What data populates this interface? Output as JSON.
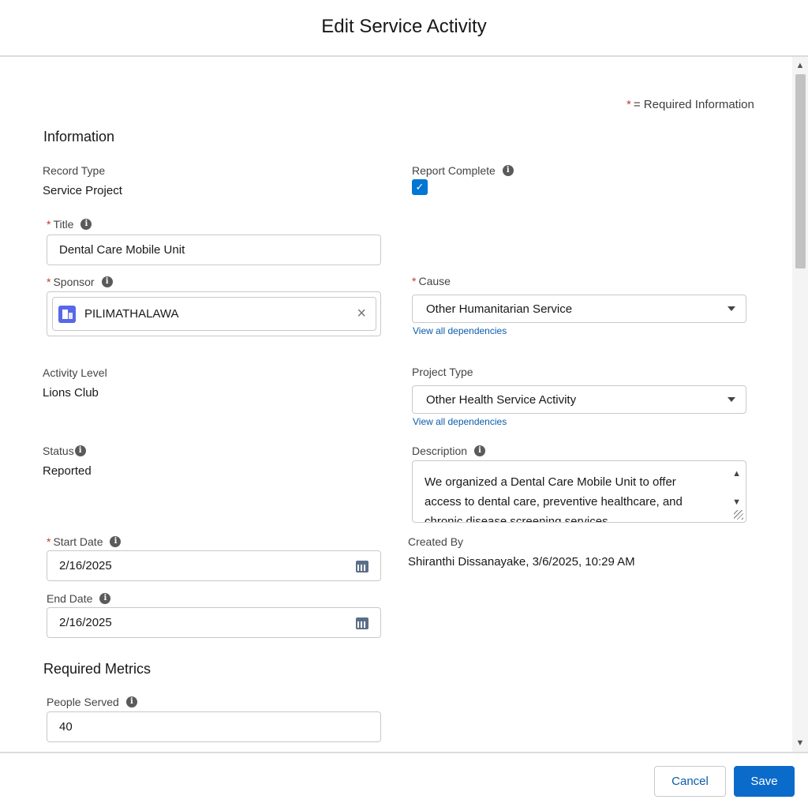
{
  "header": {
    "title": "Edit Service Activity"
  },
  "required_legend": {
    "star": "*",
    "text": "= Required Information"
  },
  "sections": {
    "information": "Information",
    "metrics": "Required Metrics"
  },
  "fields": {
    "record_type": {
      "label": "Record Type",
      "value": "Service Project"
    },
    "report_complete": {
      "label": "Report Complete",
      "checked": true
    },
    "title": {
      "label": "Title",
      "value": "Dental Care Mobile Unit",
      "required": true
    },
    "sponsor": {
      "label": "Sponsor",
      "value": "PILIMATHALAWA",
      "required": true,
      "icon": "account-icon"
    },
    "cause": {
      "label": "Cause",
      "value": "Other Humanitarian Service",
      "required": true,
      "link": "View all dependencies"
    },
    "activity_level": {
      "label": "Activity Level",
      "value": "Lions Club"
    },
    "project_type": {
      "label": "Project Type",
      "value": "Other Health Service Activity",
      "link": "View all dependencies"
    },
    "status": {
      "label": "Status",
      "value": "Reported"
    },
    "description": {
      "label": "Description",
      "value": "We organized a Dental Care Mobile Unit to offer access to dental care, preventive healthcare, and chronic disease screening services."
    },
    "start_date": {
      "label": "Start Date",
      "value": "2/16/2025",
      "required": true
    },
    "end_date": {
      "label": "End Date",
      "value": "2/16/2025"
    },
    "created_by": {
      "label": "Created By",
      "value": "Shiranthi Dissanayake, 3/6/2025, 10:29 AM"
    },
    "people_served": {
      "label": "People Served",
      "value": "40"
    }
  },
  "footer": {
    "cancel_label": "Cancel",
    "save_label": "Save"
  },
  "colors": {
    "brand": "#0b6bcb",
    "required": "#c23934",
    "link": "#0b5cab",
    "checkbox": "#0176d3"
  }
}
